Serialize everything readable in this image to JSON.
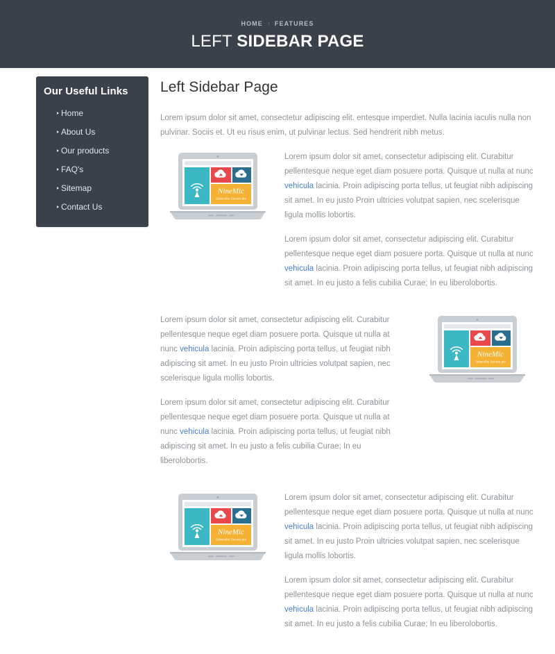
{
  "banner": {
    "breadcrumb": {
      "home": "HOME",
      "separator": "›",
      "current": "FEATURES"
    },
    "title_light": "LEFT ",
    "title_bold": "SIDEBAR PAGE"
  },
  "sidebar": {
    "widget_title": "Our Useful Links",
    "items": [
      {
        "label": "Home"
      },
      {
        "label": "About Us"
      },
      {
        "label": "Our products"
      },
      {
        "label": "FAQ's"
      },
      {
        "label": "Sitemap"
      },
      {
        "label": "Contact Us"
      }
    ]
  },
  "main": {
    "heading": "Left Sidebar Page",
    "intro": "Lorem ipsum dolor sit amet, consectetur adipiscing elit. entesque imperdiet. Nulla lacinia iaculis nulla non pulvinar. Sociis et. Ut eu risus enim, ut pulvinar lectus. Sed hendrerit nibh metus.",
    "paragraph_a_part1": "Lorem ipsum dolor sit amet, consectetur adipiscing elit. Curabitur pellentesque neque eget diam posuere porta. Quisque ut nulla at nunc ",
    "paragraph_a_link": "vehicula",
    "paragraph_a_part2": " lacinia. Proin adipiscing porta tellus, ut feugiat nibh adipiscing sit amet. In eu justo Proin ultricies volutpat sapien, nec scelerisque ligula mollis lobortis.",
    "paragraph_b_part1": "Lorem ipsum dolor sit amet, consectetur adipiscing elit. Curabitur pellentesque neque eget diam posuere porta. Quisque ut nulla at nunc ",
    "paragraph_b_link": "vehicula",
    "paragraph_b_part2": " lacinia. Proin adipiscing porta tellus, ut feugiat nibh adipiscing sit amet. In eu justo a felis cubilia Curae; In eu liberolobortis."
  },
  "illustration": {
    "brand": "NineMic",
    "tagline": "Subscribe Secure pto",
    "tile_colors": {
      "teal": "#3bb8c3",
      "red": "#e8474b",
      "blue": "#2a6e8f",
      "orange": "#f5b133"
    },
    "laptop_body": "#c9ced3",
    "laptop_shell": "#aeb5bb"
  },
  "theme": {
    "dark": "#3a414b",
    "link": "#4a7fd4",
    "body_text": "#8e9397",
    "heading": "#333333"
  }
}
